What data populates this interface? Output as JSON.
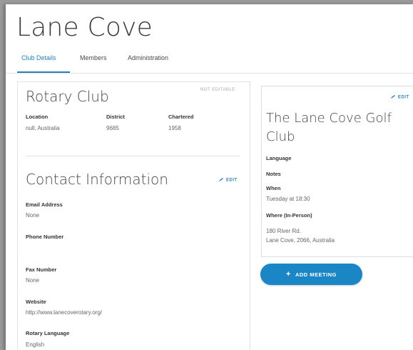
{
  "page": {
    "title": "Lane Cove"
  },
  "tabs": [
    {
      "label": "Club Details",
      "active": true
    },
    {
      "label": "Members",
      "active": false
    },
    {
      "label": "Administration",
      "active": false
    }
  ],
  "club": {
    "heading": "Rotary Club",
    "not_editable": "NOT EDITABLE",
    "location_label": "Location",
    "location_value": "null, Australia",
    "district_label": "District",
    "district_value": "9685",
    "chartered_label": "Chartered",
    "chartered_value": "1958"
  },
  "contact": {
    "heading": "Contact Information",
    "edit_label": "EDIT",
    "email_label": "Email Address",
    "email_value": "None",
    "phone_label": "Phone Number",
    "phone_value": "",
    "fax_label": "Fax Number",
    "fax_value": "None",
    "website_label": "Website",
    "website_value": "http://www.lanecoverotary.org/",
    "language_label": "Rotary Language",
    "language_value": "English"
  },
  "meeting": {
    "edit_label": "EDIT",
    "name": "The Lane Cove Golf Club",
    "language_label": "Language",
    "notes_label": "Notes",
    "when_label": "When",
    "when_value": "Tuesday at 18:30",
    "where_label": "Where (In-Person)",
    "address_line1": "180 River Rd.",
    "address_line2": "Lane Cove, 2066, Australia"
  },
  "actions": {
    "add_meeting": "ADD MEETING"
  },
  "colors": {
    "accent": "#1a86c5",
    "link": "#2a7fb8"
  }
}
